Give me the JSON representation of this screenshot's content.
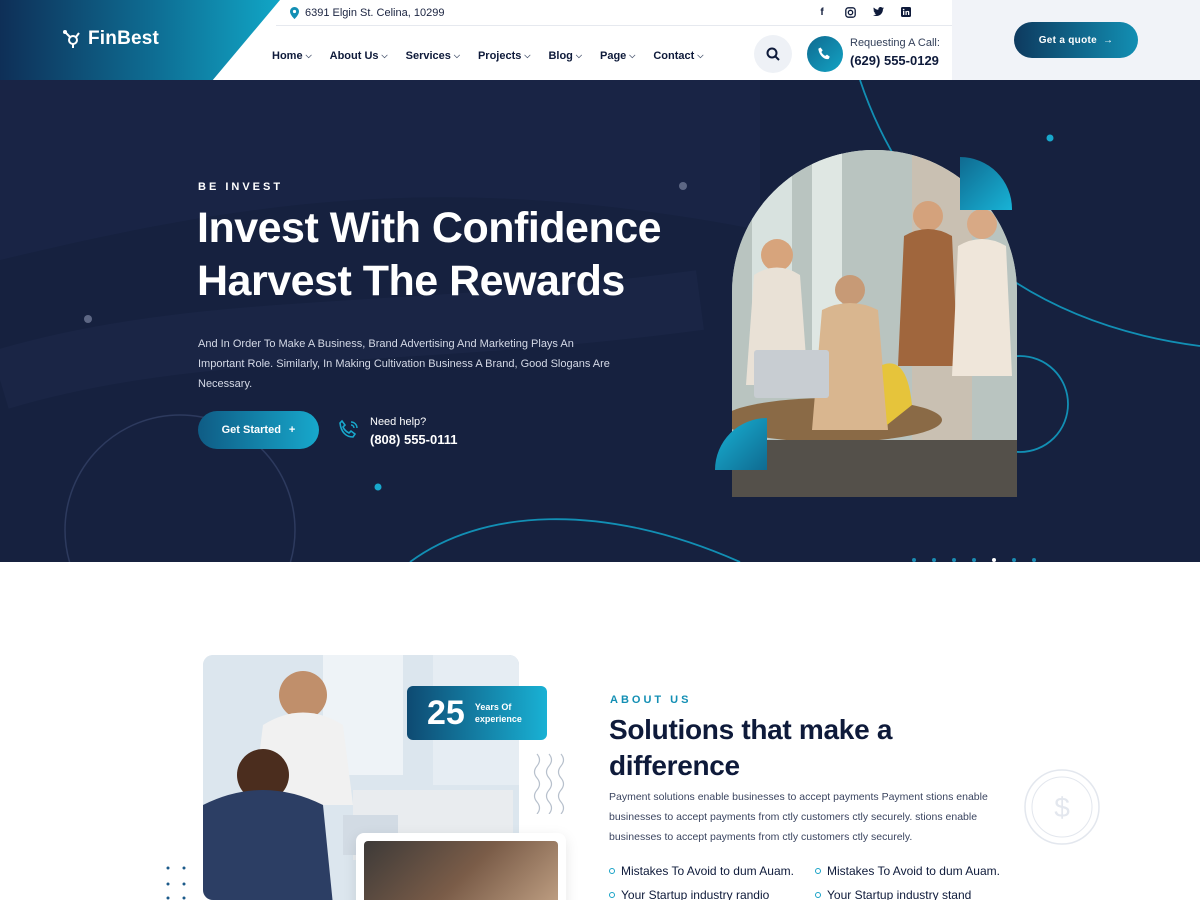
{
  "colors": {
    "navy": "#16213f",
    "accent": "#18a2c6",
    "dark_text": "#0e1a3a"
  },
  "header": {
    "logo_text": "FinBest",
    "address": "6391 Elgin St. Celina, 10299",
    "socials": [
      "facebook-icon",
      "instagram-icon",
      "twitter-icon",
      "linkedin-icon"
    ],
    "nav": [
      "Home",
      "About Us",
      "Services",
      "Projects",
      "Blog",
      "Page",
      "Contact"
    ],
    "call_label": "Requesting A Call:",
    "call_number": "(629) 555-0129",
    "quote_button": "Get a quote"
  },
  "hero": {
    "eyebrow": "BE INVEST",
    "title_line1": "Invest With Confidence",
    "title_line2": "Harvest The Rewards",
    "description": "And In Order To Make A Business, Brand Advertising And Marketing Plays An Important Role. Similarly, In Making Cultivation Business A Brand, Good Slogans Are Necessary.",
    "cta": "Get Started",
    "help_label": "Need help?",
    "help_number": "(808) 555-0111",
    "slider_total": 7,
    "slider_active": 4
  },
  "about": {
    "experience_number": "25",
    "experience_label": "Years Of experience",
    "eyebrow": "ABOUT US",
    "title": "Solutions that make a difference",
    "description": "Payment solutions enable businesses to accept payments Payment stions enable businesses to accept payments from ctly customers ctly securely. stions enable businesses to accept payments from ctly customers ctly securely.",
    "features": [
      "Mistakes To Avoid to dum Auam.",
      "Mistakes To Avoid to dum Auam.",
      "Your Startup industry randio",
      "Your Startup industry stand"
    ]
  }
}
